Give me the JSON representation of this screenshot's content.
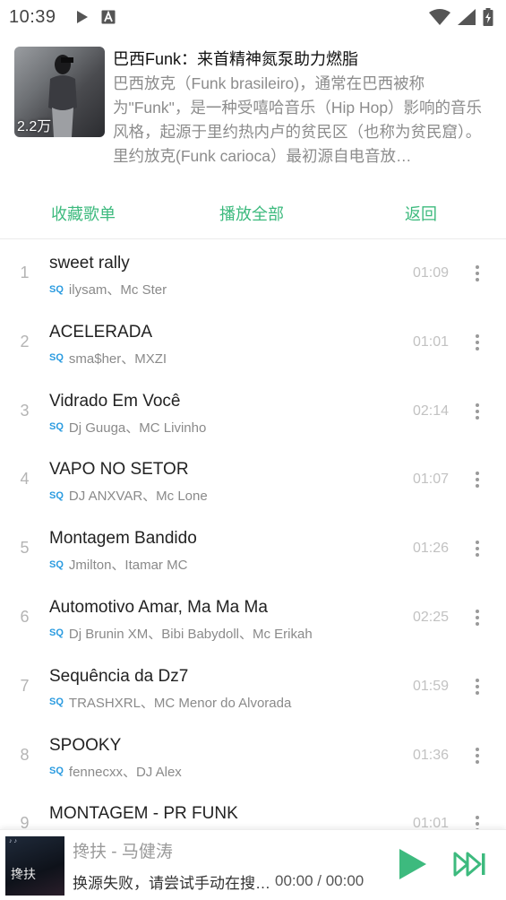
{
  "status_bar": {
    "time": "10:39",
    "icons": [
      "play-icon",
      "a-icon",
      "wifi-icon",
      "signal-icon",
      "battery-charging-icon"
    ]
  },
  "playlist": {
    "title": "巴西Funk：来首精神氮泵助力燃脂",
    "description": "巴西放克（Funk brasileiro)，通常在巴西被称为\"Funk\"，是一种受嘻哈音乐（Hip Hop）影响的音乐风格，起源于里约热内卢的贫民区（也称为贫民窟）。里约放克(Funk carioca）最初源自电音放…",
    "play_count": "2.2万"
  },
  "actions": {
    "collect": "收藏歌单",
    "play_all": "播放全部",
    "back": "返回"
  },
  "tracks": [
    {
      "index": "1",
      "title": "sweet rally",
      "artist": "ilysam、Mc Ster",
      "duration": "01:09",
      "badge": "SQ"
    },
    {
      "index": "2",
      "title": "ACELERADA",
      "artist": "sma$her、MXZI",
      "duration": "01:01",
      "badge": "SQ"
    },
    {
      "index": "3",
      "title": "Vidrado Em Você",
      "artist": "Dj Guuga、MC Livinho",
      "duration": "02:14",
      "badge": "SQ"
    },
    {
      "index": "4",
      "title": "VAPO NO SETOR",
      "artist": "DJ ANXVAR、Mc Lone",
      "duration": "01:07",
      "badge": "SQ"
    },
    {
      "index": "5",
      "title": "Montagem Bandido",
      "artist": "Jmilton、Itamar MC",
      "duration": "01:26",
      "badge": "SQ"
    },
    {
      "index": "6",
      "title": "Automotivo Amar, Ma Ma Ma",
      "artist": "Dj Brunin XM、Bibi Babydoll、Mc Erikah",
      "duration": "02:25",
      "badge": "SQ"
    },
    {
      "index": "7",
      "title": "Sequência da Dz7",
      "artist": "TRASHXRL、MC Menor do Alvorada",
      "duration": "01:59",
      "badge": "SQ"
    },
    {
      "index": "8",
      "title": "SPOOKY",
      "artist": "fennecxx、DJ Alex",
      "duration": "01:36",
      "badge": "SQ"
    },
    {
      "index": "9",
      "title": "MONTAGEM - PR FUNK",
      "artist": "",
      "duration": "01:01",
      "badge": ""
    }
  ],
  "mini_player": {
    "title": "搀扶 - 马健涛",
    "status": "换源失败，请尝试手动在搜…",
    "time": "00:00 / 00:00",
    "cover_text": "搀扶",
    "accent_color": "#3dba7e"
  },
  "colors": {
    "accent": "#3dba7e",
    "sq_badge": "#2a9be0"
  }
}
